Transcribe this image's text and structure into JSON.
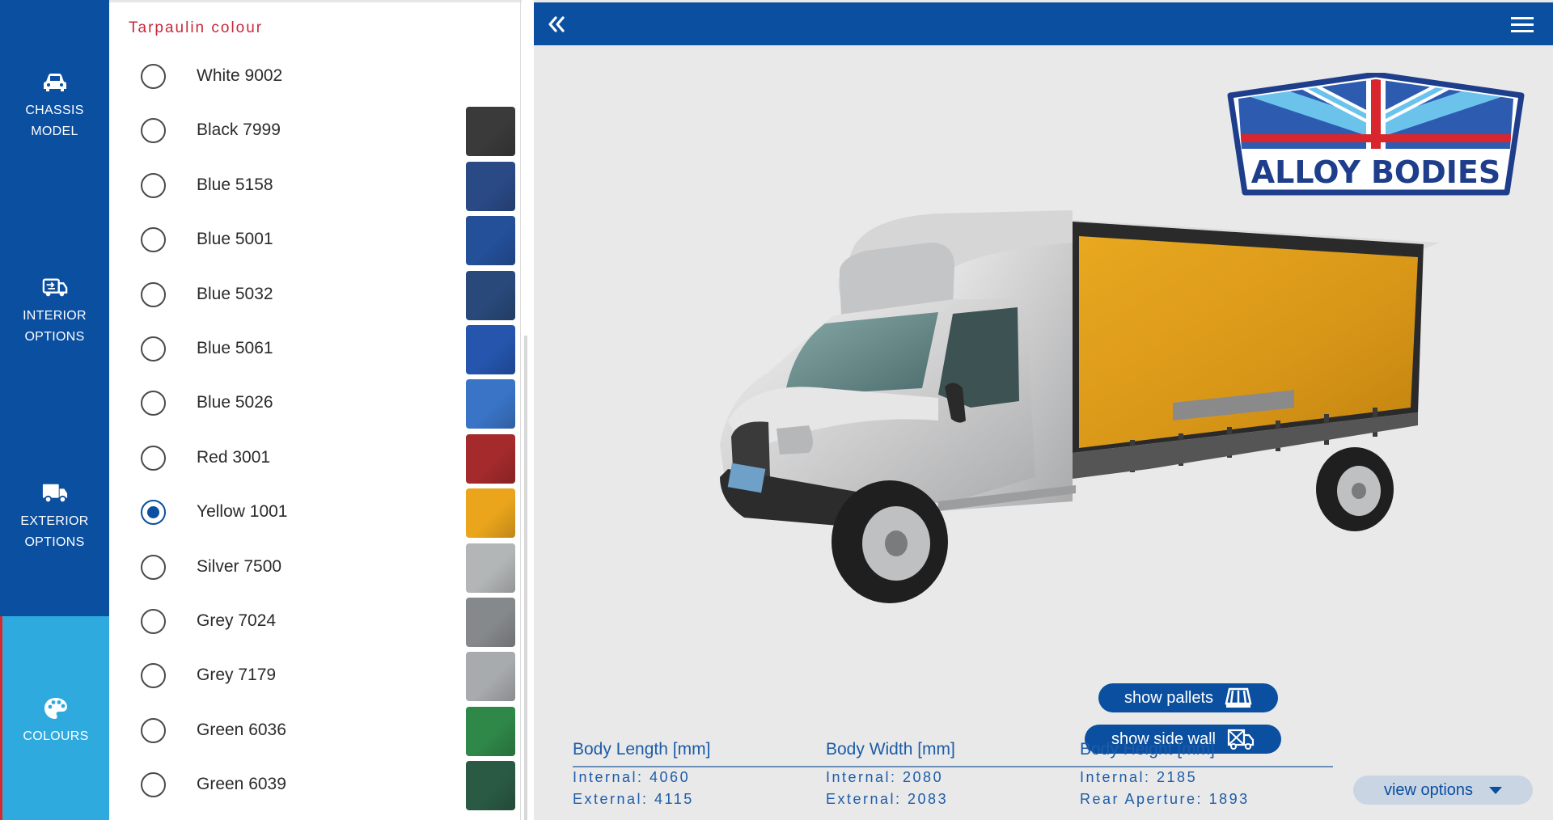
{
  "nav": {
    "items": [
      {
        "label": "CHASSIS\nMODEL",
        "icon": "car-icon"
      },
      {
        "label": "INTERIOR\nOPTIONS",
        "icon": "truck-interior-icon"
      },
      {
        "label": "EXTERIOR\nOPTIONS",
        "icon": "truck-icon"
      },
      {
        "label": "COLOURS",
        "icon": "palette-icon",
        "active": true
      }
    ]
  },
  "panel": {
    "title": "Tarpaulin colour",
    "options": [
      {
        "label": "White 9002",
        "swatch": "",
        "selected": false
      },
      {
        "label": "Black 7999",
        "swatch": "#3a3a3a",
        "selected": false
      },
      {
        "label": "Blue 5158",
        "swatch": "#2a4a86",
        "selected": false
      },
      {
        "label": "Blue 5001",
        "swatch": "#24509a",
        "selected": false
      },
      {
        "label": "Blue 5032",
        "swatch": "#29497a",
        "selected": false
      },
      {
        "label": "Blue 5061",
        "swatch": "#2555ad",
        "selected": false
      },
      {
        "label": "Blue 5026",
        "swatch": "#3a74c6",
        "selected": false
      },
      {
        "label": "Red 3001",
        "swatch": "#a42a2c",
        "selected": false
      },
      {
        "label": "Yellow 1001",
        "swatch": "#eaa51c",
        "selected": true
      },
      {
        "label": "Silver 7500",
        "swatch": "#b3b6b7",
        "selected": false
      },
      {
        "label": "Grey 7024",
        "swatch": "#86898b",
        "selected": false
      },
      {
        "label": "Grey 7179",
        "swatch": "#a8abad",
        "selected": false
      },
      {
        "label": "Green 6036",
        "swatch": "#2f8748",
        "selected": false
      },
      {
        "label": "Green 6039",
        "swatch": "#2a5a44",
        "selected": false
      }
    ]
  },
  "viewer": {
    "logo_text": "ALLOY BODIES",
    "show_pallets": "show pallets",
    "show_side_wall": "show side wall",
    "view_options": "view options",
    "dimensions": [
      {
        "heading": "Body Length [mm]",
        "line1": "Internal: 4060",
        "line2": "External: 4115"
      },
      {
        "heading": "Body Width [mm]",
        "line1": "Internal: 2080",
        "line2": "External: 2083"
      },
      {
        "heading": "Body Height [mm]",
        "line1": "Internal: 2185",
        "line2": "Rear Aperture: 1893"
      }
    ]
  },
  "colors": {
    "brand_blue": "#0b4fa0",
    "active_nav": "#2eaadf",
    "tarp": "#e0a01a"
  }
}
